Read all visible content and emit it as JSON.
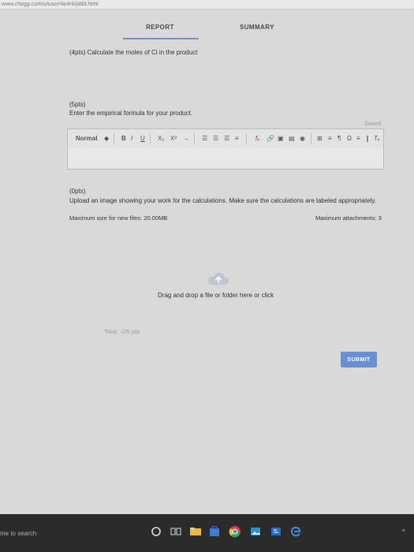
{
  "browser": {
    "url": "www.chegg.com/u/user/4e4r6/pbbl.html"
  },
  "tabs": [
    {
      "label": "REPORT"
    },
    {
      "label": "SUMMARY"
    }
  ],
  "q1": {
    "title": "(4pts)  Calculate the moles of Cl in the product"
  },
  "q2": {
    "points": "(5pts)",
    "prompt": "Enter the empirical formula for your product.",
    "saved": "Saved",
    "toolbar": {
      "style_select": "Normal",
      "bold": "B",
      "italic": "I",
      "underline": "U",
      "subscript": "X₂",
      "superscript": "X²",
      "formula": "fₓ",
      "clear": "Tₓ"
    }
  },
  "q3": {
    "points": "(0pts)",
    "prompt": "Upload an image showing your work for the calculations. Make sure the calculations are labeled appropriately.",
    "max_size": "Maximum size for new files:  20.00MB",
    "max_attachments": "Maximum attachments: 3",
    "dropzone": "Drag and drop a file or folder here or click"
  },
  "total": "Total: -/25 pts",
  "submit": "SUBMIT",
  "taskbar": {
    "search": "me to search"
  }
}
